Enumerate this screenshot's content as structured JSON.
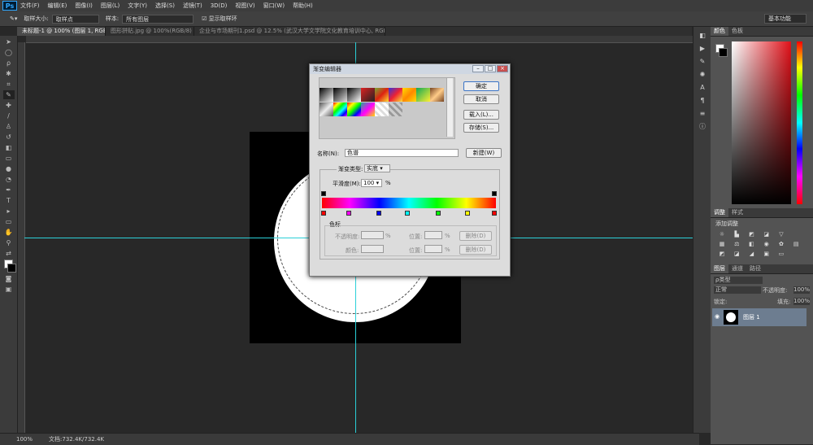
{
  "app": {
    "logo": "Ps"
  },
  "menu": [
    "文件(F)",
    "编辑(E)",
    "图像(I)",
    "图层(L)",
    "文字(Y)",
    "选择(S)",
    "滤镜(T)",
    "3D(D)",
    "视图(V)",
    "窗口(W)",
    "帮助(H)"
  ],
  "options": {
    "sample_size_label": "取样大小:",
    "sample_size_value": "取样点",
    "sample_label": "样本:",
    "sample_value": "所有图层",
    "show_ring_label": "显示取样环",
    "workspace": "基本功能"
  },
  "tabs": [
    "未标题-1 @ 100% (图层 1, RGB/8) *",
    "图形拼贴.jpg @ 100%(RGB/8)",
    "企业与市场期刊1.psd @ 12.5% (武汉大学文学院文化教育培训中心, RGB/8) *"
  ],
  "status": {
    "zoom": "100%",
    "doc": "文档:732.4K/732.4K"
  },
  "panels": {
    "color_tabs": [
      "颜色",
      "色板"
    ],
    "adjust_tabs": [
      "调整",
      "样式"
    ],
    "adjust_title": "添加调整",
    "layers_tabs": [
      "图层",
      "通道",
      "路径"
    ],
    "kind": "ρ类型",
    "blend": "正常",
    "opacity_label": "不透明度:",
    "opacity": "100%",
    "lock_label": "锁定:",
    "fill_label": "填充:",
    "fill": "100%",
    "layer_name": "图层 1"
  },
  "dialog": {
    "title": "渐变编辑器",
    "presets_label": "预设",
    "ok": "确定",
    "cancel": "取消",
    "load": "载入(L)...",
    "save": "存储(S)...",
    "name_label": "名称(N):",
    "name_value": "色谱",
    "new": "新建(W)",
    "type_label": "渐变类型:",
    "type_value": "实底",
    "smooth_label": "平滑度(M):",
    "smooth_value": "100",
    "smooth_unit": "%",
    "stops_label": "色标",
    "opacity_label": "不透明度:",
    "opacity_unit": "%",
    "location_label": "位置:",
    "location_unit": "%",
    "delete": "删除(D)",
    "color_label": "颜色:",
    "color_location_label": "位置:",
    "color_location_unit": "%",
    "color_delete": "删除(D)"
  },
  "colors": {
    "accent": "#31a8ff",
    "guide": "#2bd0d8",
    "layer_selected": "#6d7d90"
  }
}
